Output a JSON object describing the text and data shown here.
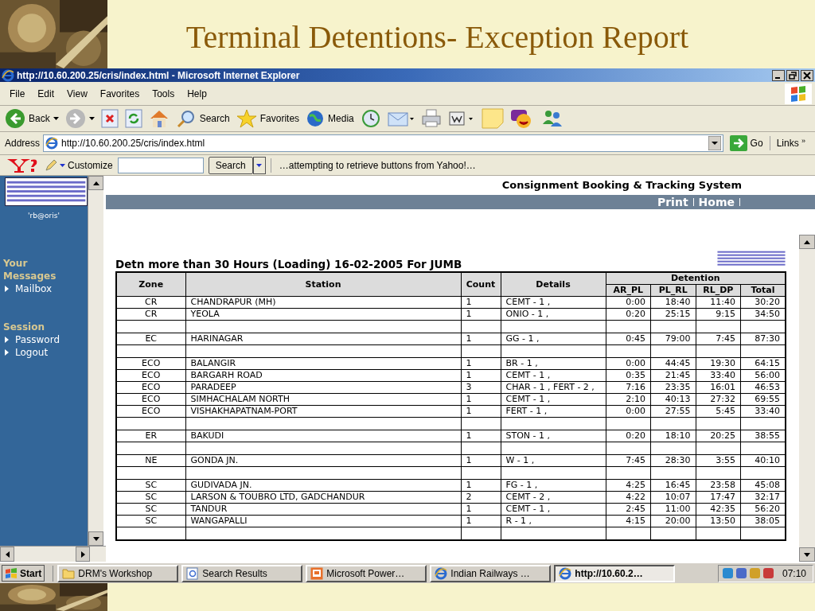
{
  "slide": {
    "title": "Terminal Detentions- Exception Report"
  },
  "window": {
    "title": "http://10.60.200.25/cris/index.html - Microsoft Internet Explorer"
  },
  "menu": [
    "File",
    "Edit",
    "View",
    "Favorites",
    "Tools",
    "Help"
  ],
  "toolbar": [
    {
      "kind": "back",
      "label": "Back"
    },
    {
      "kind": "forward"
    },
    {
      "kind": "stop"
    },
    {
      "kind": "refresh"
    },
    {
      "kind": "home"
    },
    {
      "kind": "search",
      "label": "Search"
    },
    {
      "kind": "favorites",
      "label": "Favorites"
    },
    {
      "kind": "media",
      "label": "Media"
    },
    {
      "kind": "history"
    },
    {
      "kind": "mail"
    },
    {
      "kind": "print"
    },
    {
      "kind": "edit"
    },
    {
      "kind": "note"
    },
    {
      "kind": "messenger"
    },
    {
      "kind": "people"
    }
  ],
  "address": {
    "label": "Address",
    "value": "http://10.60.200.25/cris/index.html",
    "go": "Go",
    "links": "Links",
    "chevron": "»"
  },
  "yahoo": {
    "customize": "Customize",
    "search_button": "Search",
    "status": "…attempting to retrieve buttons from Yahoo!…"
  },
  "sidebar": {
    "user": "'rb@oris'",
    "sections": [
      {
        "heading": "Your Messages",
        "items": [
          "Mailbox"
        ]
      },
      {
        "heading": "Session",
        "items": [
          "Password",
          "Logout"
        ]
      }
    ]
  },
  "header": {
    "title": "Consignment Booking & Tracking System",
    "links": [
      "Print",
      "Home"
    ]
  },
  "report": {
    "heading": "Detn more than 30 Hours (Loading) 16-02-2005 For JUMB",
    "columns": [
      "Zone",
      "Station",
      "Count",
      "Details"
    ],
    "group": "Detention",
    "subcolumns": [
      "AR_PL",
      "PL_RL",
      "RL_DP",
      "Total"
    ],
    "rows": [
      {
        "kind": "data",
        "cells": [
          "CR",
          "CHANDRAPUR (MH)",
          "1",
          "CEMT - 1 ,",
          "0:00",
          "18:40",
          "11:40",
          "30:20"
        ]
      },
      {
        "kind": "data",
        "cells": [
          "CR",
          "YEOLA",
          "1",
          "ONIO - 1 ,",
          "0:20",
          "25:15",
          "9:15",
          "34:50"
        ]
      },
      {
        "kind": "blank"
      },
      {
        "kind": "data",
        "cells": [
          "EC",
          "HARINAGAR",
          "1",
          "GG - 1 ,",
          "0:45",
          "79:00",
          "7:45",
          "87:30"
        ]
      },
      {
        "kind": "blank"
      },
      {
        "kind": "data",
        "cells": [
          "ECO",
          "BALANGIR",
          "1",
          "BR - 1 ,",
          "0:00",
          "44:45",
          "19:30",
          "64:15"
        ]
      },
      {
        "kind": "data",
        "cells": [
          "ECO",
          "BARGARH ROAD",
          "1",
          "CEMT - 1 ,",
          "0:35",
          "21:45",
          "33:40",
          "56:00"
        ]
      },
      {
        "kind": "data",
        "cells": [
          "ECO",
          "PARADEEP",
          "3",
          "CHAR - 1 , FERT - 2 ,",
          "7:16",
          "23:35",
          "16:01",
          "46:53"
        ]
      },
      {
        "kind": "data",
        "cells": [
          "ECO",
          "SIMHACHALAM NORTH",
          "1",
          "CEMT - 1 ,",
          "2:10",
          "40:13",
          "27:32",
          "69:55"
        ]
      },
      {
        "kind": "data",
        "cells": [
          "ECO",
          "VISHAKHAPATNAM-PORT",
          "1",
          "FERT - 1 ,",
          "0:00",
          "27:55",
          "5:45",
          "33:40"
        ]
      },
      {
        "kind": "blank"
      },
      {
        "kind": "data",
        "cells": [
          "ER",
          "BAKUDI",
          "1",
          "STON - 1 ,",
          "0:20",
          "18:10",
          "20:25",
          "38:55"
        ]
      },
      {
        "kind": "blank"
      },
      {
        "kind": "data",
        "cells": [
          "NE",
          "GONDA JN.",
          "1",
          "W - 1 ,",
          "7:45",
          "28:30",
          "3:55",
          "40:10"
        ]
      },
      {
        "kind": "blank"
      },
      {
        "kind": "data",
        "cells": [
          "SC",
          "GUDIVADA JN.",
          "1",
          "FG - 1 ,",
          "4:25",
          "16:45",
          "23:58",
          "45:08"
        ]
      },
      {
        "kind": "data",
        "cells": [
          "SC",
          "LARSON & TOUBRO LTD, GADCHANDUR",
          "2",
          "CEMT - 2 ,",
          "4:22",
          "10:07",
          "17:47",
          "32:17"
        ]
      },
      {
        "kind": "data",
        "cells": [
          "SC",
          "TANDUR",
          "1",
          "CEMT - 1 ,",
          "2:45",
          "11:00",
          "42:35",
          "56:20"
        ]
      },
      {
        "kind": "data",
        "cells": [
          "SC",
          "WANGAPALLI",
          "1",
          "R - 1 ,",
          "4:15",
          "20:00",
          "13:50",
          "38:05"
        ]
      },
      {
        "kind": "blank"
      }
    ]
  },
  "taskbar": {
    "start": "Start",
    "items": [
      {
        "kind": "folder",
        "label": "DRM's Workshop",
        "selected": false
      },
      {
        "kind": "search",
        "label": "Search Results",
        "selected": false
      },
      {
        "kind": "slides",
        "label": "Microsoft Power…",
        "selected": false
      },
      {
        "kind": "ie",
        "label": "Indian Railways …",
        "selected": false
      },
      {
        "kind": "ie",
        "label": "http://10.60.2…",
        "selected": true
      }
    ],
    "clock": "07:10"
  }
}
